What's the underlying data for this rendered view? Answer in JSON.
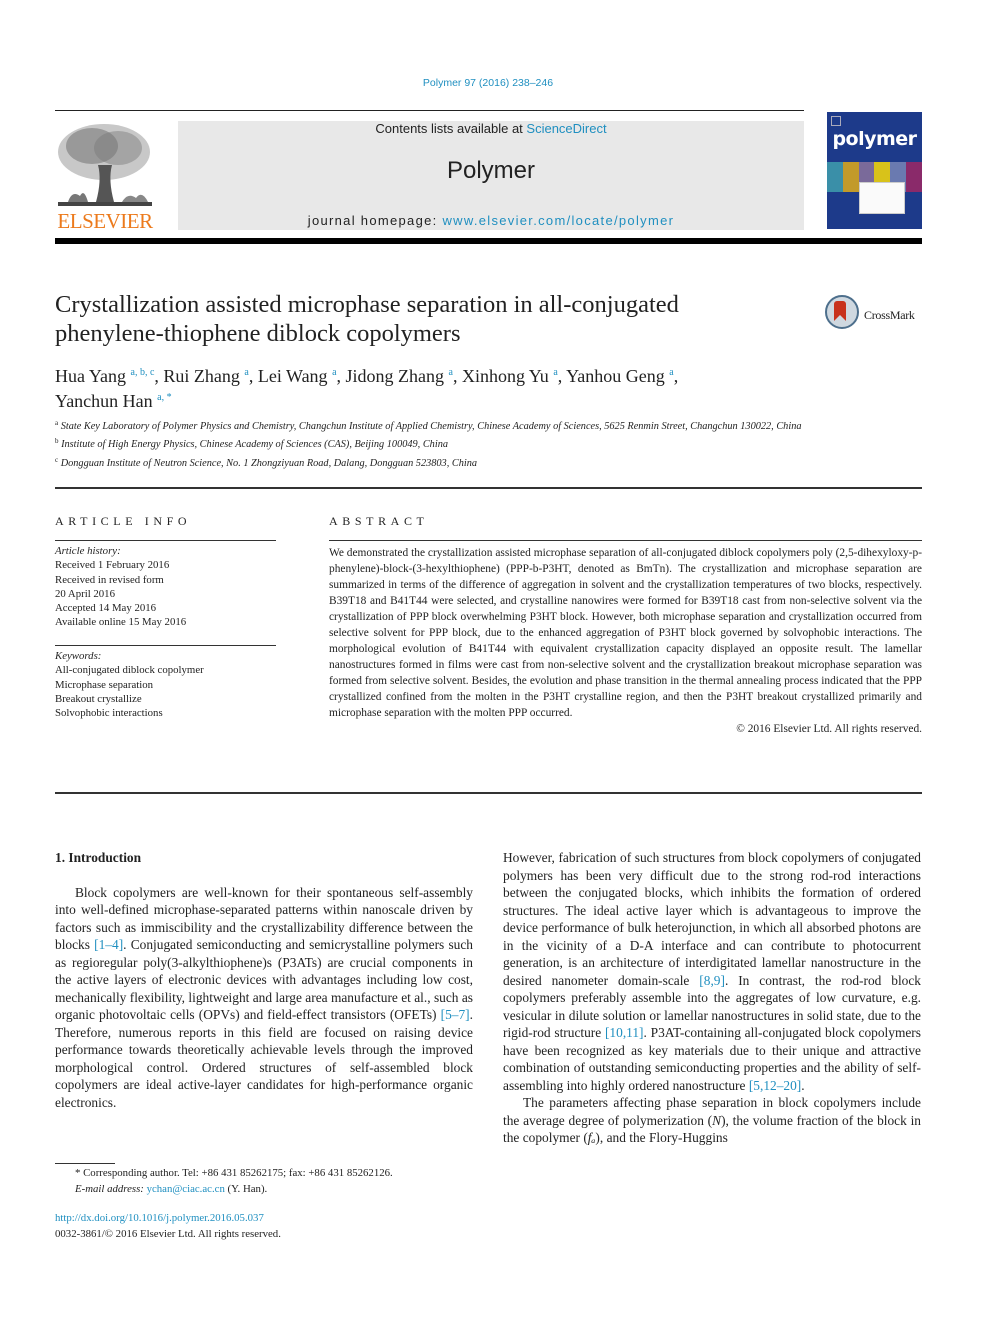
{
  "header": {
    "journal_ref": "Polymer 97 (2016) 238–246",
    "contents_prefix": "Contents lists available at ",
    "contents_link": "ScienceDirect",
    "journal_title": "Polymer",
    "homepage_prefix": "journal homepage: ",
    "homepage_url": "www.elsevier.com/locate/polymer",
    "publisher_logo_text": "ELSEVIER",
    "cover_title": "polymer",
    "crossmark_label": "CrossMark"
  },
  "article": {
    "title_line1": "Crystallization assisted microphase separation in all-conjugated",
    "title_line2": "phenylene-thiophene diblock copolymers",
    "authors": [
      {
        "name": "Hua Yang",
        "sup": "a, b, c",
        "sep": ", "
      },
      {
        "name": "Rui Zhang",
        "sup": "a",
        "sep": ", "
      },
      {
        "name": "Lei Wang",
        "sup": "a",
        "sep": ", "
      },
      {
        "name": "Jidong Zhang",
        "sup": "a",
        "sep": ", "
      },
      {
        "name": "Xinhong Yu",
        "sup": "a",
        "sep": ", "
      },
      {
        "name": "Yanhou Geng",
        "sup": "a",
        "sep": ","
      },
      {
        "name": "Yanchun Han",
        "sup": "a, *",
        "sep": ""
      }
    ],
    "affiliations": [
      {
        "sup": "a",
        "text": "State Key Laboratory of Polymer Physics and Chemistry, Changchun Institute of Applied Chemistry, Chinese Academy of Sciences, 5625 Renmin Street, Changchun 130022, China"
      },
      {
        "sup": "b",
        "text": "Institute of High Energy Physics, Chinese Academy of Sciences (CAS), Beijing 100049, China"
      },
      {
        "sup": "c",
        "text": "Dongguan Institute of Neutron Science, No. 1 Zhongziyuan Road, Dalang, Dongguan 523803, China"
      }
    ]
  },
  "article_info": {
    "heading": "ARTICLE INFO",
    "history_label": "Article history:",
    "history": [
      "Received 1 February 2016",
      "Received in revised form",
      "20 April 2016",
      "Accepted 14 May 2016",
      "Available online 15 May 2016"
    ],
    "keywords_label": "Keywords:",
    "keywords": [
      "All-conjugated diblock copolymer",
      "Microphase separation",
      "Breakout crystallize",
      "Solvophobic interactions"
    ]
  },
  "abstract": {
    "heading": "ABSTRACT",
    "text": "We demonstrated the crystallization assisted microphase separation of all-conjugated diblock copolymers poly (2,5-dihexyloxy-p-phenylene)-block-(3-hexylthiophene) (PPP-b-P3HT, denoted as BmTn). The crystallization and microphase separation are summarized in terms of the difference of aggregation in solvent and the crystallization temperatures of two blocks, respectively. B39T18 and B41T44 were selected, and crystalline nanowires were formed for B39T18 cast from non-selective solvent via the crystallization of PPP block overwhelming P3HT block. However, both microphase separation and crystallization occurred from selective solvent for PPP block, due to the enhanced aggregation of P3HT block governed by solvophobic interactions. The morphological evolution of B41T44 with equivalent crystallization capacity displayed an opposite result. The lamellar nanostructures formed in films were cast from non-selective solvent and the crystallization breakout microphase separation was formed from selective solvent. Besides, the evolution and phase transition in the thermal annealing process indicated that the PPP crystallized confined from the molten in the P3HT crystalline region, and then the P3HT breakout crystallized primarily and microphase separation with the molten PPP occurred.",
    "copyright": "© 2016 Elsevier Ltd. All rights reserved."
  },
  "body": {
    "section_heading": "1.  Introduction",
    "left_para": [
      {
        "t": "Block copolymers are well-known for their spontaneous self-assembly into well-defined microphase-separated patterns within nanoscale driven by factors such as immiscibility and the crystallizability difference between the blocks "
      },
      {
        "c": "[1–4]"
      },
      {
        "t": ". Conjugated semiconducting and semicrystalline polymers such as regioregular poly(3-alkylthiophene)s (P3ATs) are crucial components in the active layers of electronic devices with advantages including low cost, mechanically flexibility, lightweight and large area manufacture et al., such as organic photovoltaic cells (OPVs) and field-effect transistors (OFETs) "
      },
      {
        "c": "[5–7]"
      },
      {
        "t": ". Therefore, numerous reports in this field are focused on raising device performance towards theoretically achievable levels through the improved morphological control. Ordered structures of self-assembled block copolymers are ideal active-layer candidates for high-performance organic electronics."
      }
    ],
    "right_para1": [
      {
        "t": "However, fabrication of such structures from block copolymers of conjugated polymers has been very difficult due to the strong rod-rod interactions between the conjugated blocks, which inhibits the formation of ordered structures. The ideal active layer which is advantageous to improve the device performance of bulk heterojunction, in which all absorbed photons are in the vicinity of a D-A interface and can contribute to photocurrent generation, is an architecture of interdigitated lamellar nanostructure in the desired nanometer domain-scale "
      },
      {
        "c": "[8,9]"
      },
      {
        "t": ". In contrast, the rod-rod block copolymers preferably assemble into the aggregates of low curvature, e.g. vesicular in dilute solution or lamellar nanostructures in solid state, due to the rigid-rod structure "
      },
      {
        "c": "[10,11]"
      },
      {
        "t": ". P3AT-containing all-conjugated block copolymers have been recognized as key materials due to their unique and attractive combination of outstanding semiconducting properties and the ability of self-assembling into highly ordered nanostructure "
      },
      {
        "c": "[5,12–20]"
      },
      {
        "t": "."
      }
    ],
    "right_para2": [
      {
        "t": "The parameters affecting phase separation in block copolymers include the average degree of polymerization ("
      },
      {
        "i": "N"
      },
      {
        "t": "), the volume fraction of the block in the copolymer ("
      },
      {
        "i": "fₐ"
      },
      {
        "t": "), and the Flory-Huggins"
      }
    ]
  },
  "footnotes": {
    "corresponding": "* Corresponding author. Tel: +86 431 85262175; fax: +86 431 85262126.",
    "email_label": "E-mail address: ",
    "email": "ychan@ciac.ac.cn",
    "email_suffix": " (Y. Han).",
    "doi": "http://dx.doi.org/10.1016/j.polymer.2016.05.037",
    "issn": "0032-3861/© 2016 Elsevier Ltd. All rights reserved."
  }
}
